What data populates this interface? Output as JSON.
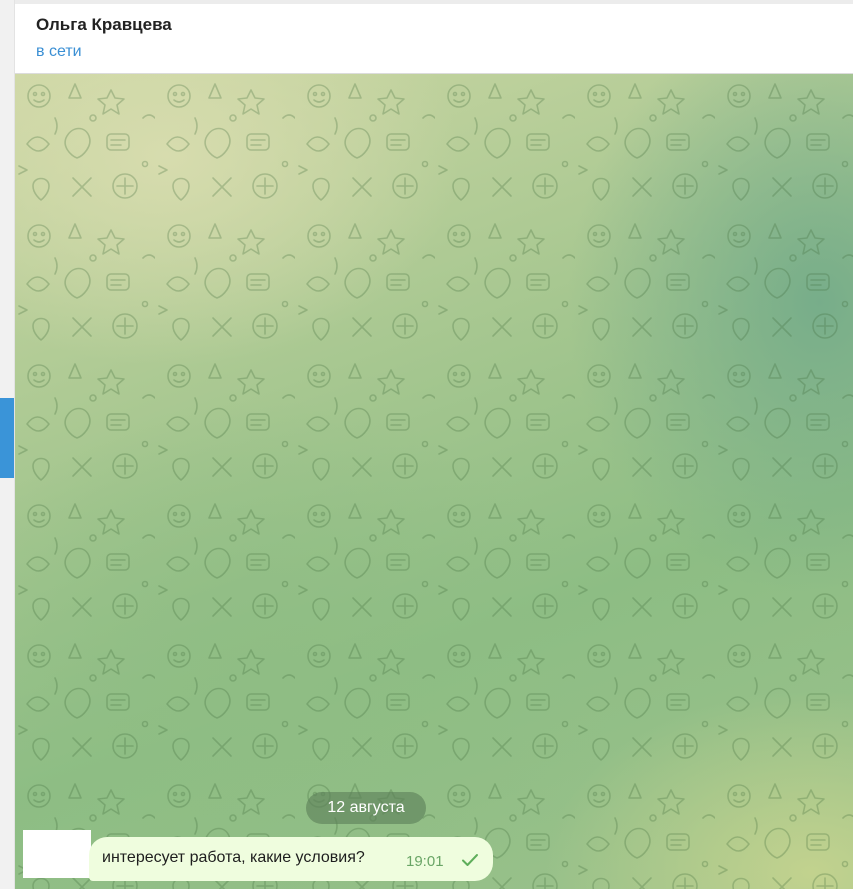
{
  "header": {
    "contact_name": "Ольга Кравцева",
    "status": "в сети"
  },
  "chat": {
    "date_separator": "12 августа",
    "messages": [
      {
        "text": "интересует работа, какие условия?",
        "time": "19:01",
        "status_icon": "single-check-icon"
      }
    ]
  },
  "colors": {
    "accent": "#3a94d8",
    "status_text": "#3a8fd4",
    "bubble_background": "#effdde",
    "time_text": "#6aa566"
  }
}
